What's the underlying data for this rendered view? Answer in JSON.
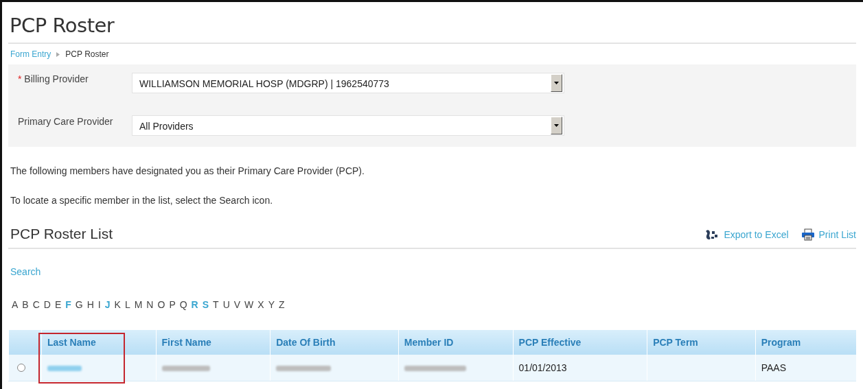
{
  "title": "PCP Roster",
  "breadcrumb": [
    {
      "label": "Form Entry",
      "link": true
    },
    {
      "label": "PCP Roster",
      "link": false
    }
  ],
  "filters": [
    {
      "marker": "*",
      "label": "Billing Provider",
      "value": "WILLIAMSON MEMORIAL HOSP (MDGRP) | 1962540773"
    },
    {
      "label": "Primary Care Provider",
      "value": "All Providers"
    }
  ],
  "paragraphs": [
    "The following members have designated you as their Primary Care Provider (PCP).",
    "To locate a specific member in the list, select the Search icon."
  ],
  "list_title": "PCP Roster List",
  "actions": [
    {
      "kind": "excel",
      "label": "Export to Excel"
    },
    {
      "kind": "print",
      "label": "Print List"
    }
  ],
  "search_link": "Search",
  "letters": [
    {
      "letter": "A",
      "active": false
    },
    {
      "letter": "B",
      "active": false
    },
    {
      "letter": "C",
      "active": false
    },
    {
      "letter": "D",
      "active": false
    },
    {
      "letter": "E",
      "active": false
    },
    {
      "letter": "F",
      "active": true
    },
    {
      "letter": "G",
      "active": false
    },
    {
      "letter": "H",
      "active": false
    },
    {
      "letter": "I",
      "active": false
    },
    {
      "letter": "J",
      "active": true
    },
    {
      "letter": "K",
      "active": false
    },
    {
      "letter": "L",
      "active": false
    },
    {
      "letter": "M",
      "active": false
    },
    {
      "letter": "N",
      "active": false
    },
    {
      "letter": "O",
      "active": false
    },
    {
      "letter": "P",
      "active": false
    },
    {
      "letter": "Q",
      "active": false
    },
    {
      "letter": "R",
      "active": true
    },
    {
      "letter": "S",
      "active": true
    },
    {
      "letter": "T",
      "active": false
    },
    {
      "letter": "U",
      "active": false
    },
    {
      "letter": "V",
      "active": false
    },
    {
      "letter": "W",
      "active": false
    },
    {
      "letter": "X",
      "active": false
    },
    {
      "letter": "Y",
      "active": false
    },
    {
      "letter": "Z",
      "active": false
    }
  ],
  "table": {
    "columns": [
      {
        "label": "Last Name",
        "highlighted": true
      },
      {
        "label": "First Name",
        "highlighted": false
      },
      {
        "label": "Date Of Birth",
        "highlighted": false
      },
      {
        "label": "Member ID",
        "highlighted": false
      },
      {
        "label": "PCP Effective",
        "highlighted": false
      },
      {
        "label": "PCP Term",
        "highlighted": false
      },
      {
        "label": "Program",
        "highlighted": false
      }
    ],
    "rows": [
      {
        "selected": false,
        "cells": [
          {
            "kind": "blurred-link"
          },
          {
            "kind": "blurred"
          },
          {
            "kind": "blurred"
          },
          {
            "kind": "blurred"
          },
          {
            "kind": "text",
            "text": "01/01/2013"
          },
          {
            "kind": "empty"
          },
          {
            "kind": "text",
            "text": "PAAS"
          }
        ]
      }
    ]
  }
}
